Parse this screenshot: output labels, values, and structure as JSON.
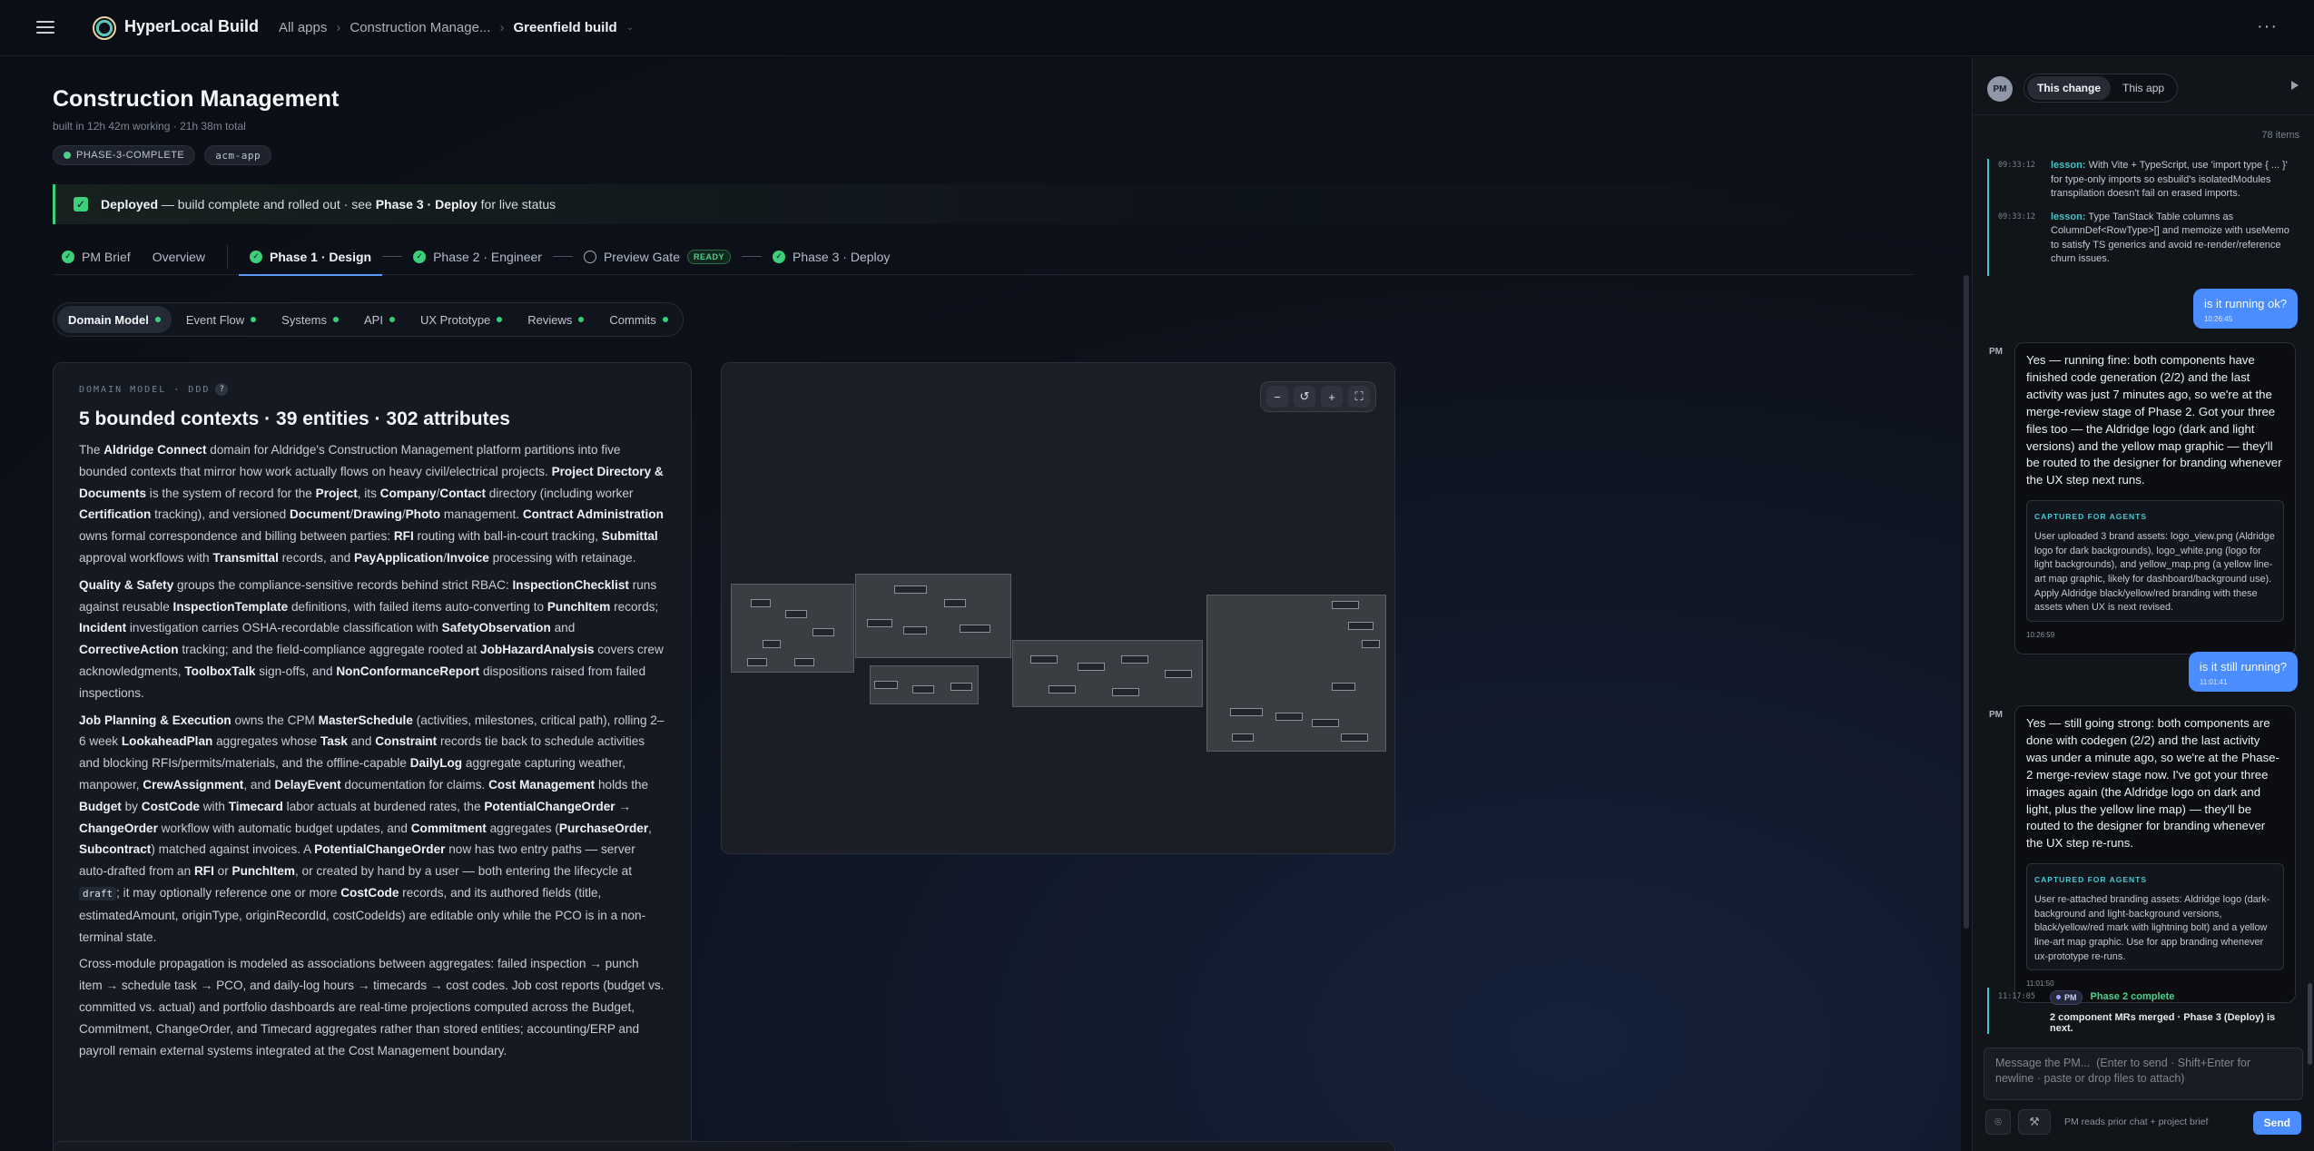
{
  "topbar": {
    "app_name": "HyperLocal Build",
    "crumbs": [
      "All apps",
      "Construction Manage...",
      "Greenfield build"
    ],
    "more": "···"
  },
  "header": {
    "title": "Construction Management",
    "meta": "built in 12h 42m working · 21h 38m total",
    "badges": [
      "PHASE-3-COMPLETE",
      "acm-app"
    ]
  },
  "banner": {
    "strong": "Deployed",
    "text": " — build complete and rolled out · see ",
    "link": "Phase 3 · Deploy",
    "tail": " for live status"
  },
  "phase_tabs": {
    "pm_brief": "PM Brief",
    "overview": "Overview",
    "phase1": "Phase 1 · Design",
    "phase2": "Phase 2 · Engineer",
    "gate": "Preview Gate",
    "ready": "READY",
    "phase3": "Phase 3 · Deploy"
  },
  "sub_tabs": [
    "Domain Model",
    "Event Flow",
    "Systems",
    "API",
    "UX Prototype",
    "Reviews",
    "Commits"
  ],
  "domain_model": {
    "eyebrow": "DOMAIN MODEL · DDD",
    "help": "?",
    "title": "5 bounded contexts · 39 entities · 302 attributes",
    "p1": [
      {
        "t": "The "
      },
      {
        "b": "Aldridge Connect"
      },
      {
        "t": " domain for Aldridge's Construction Management platform partitions into five bounded contexts that mirror how work actually flows on heavy civil/electrical projects. "
      },
      {
        "b": "Project Directory & Documents"
      },
      {
        "t": " is the system of record for the "
      },
      {
        "b": "Project"
      },
      {
        "t": ", its "
      },
      {
        "b": "Company"
      },
      {
        "t": "/"
      },
      {
        "b": "Contact"
      },
      {
        "t": " directory (including worker "
      },
      {
        "b": "Certification"
      },
      {
        "t": " tracking), and versioned "
      },
      {
        "b": "Document"
      },
      {
        "t": "/"
      },
      {
        "b": "Drawing"
      },
      {
        "t": "/"
      },
      {
        "b": "Photo"
      },
      {
        "t": " management. "
      },
      {
        "b": "Contract Administration"
      },
      {
        "t": " owns formal correspondence and billing between parties: "
      },
      {
        "b": "RFI"
      },
      {
        "t": " routing with ball-in-court tracking, "
      },
      {
        "b": "Submittal"
      },
      {
        "t": " approval workflows with "
      },
      {
        "b": "Transmittal"
      },
      {
        "t": " records, and "
      },
      {
        "b": "PayApplication"
      },
      {
        "t": "/"
      },
      {
        "b": "Invoice"
      },
      {
        "t": " processing with retainage."
      }
    ],
    "p2": [
      {
        "b": "Quality & Safety"
      },
      {
        "t": " groups the compliance-sensitive records behind strict RBAC: "
      },
      {
        "b": "InspectionChecklist"
      },
      {
        "t": " runs against reusable "
      },
      {
        "b": "InspectionTemplate"
      },
      {
        "t": " definitions, with failed items auto-converting to "
      },
      {
        "b": "PunchItem"
      },
      {
        "t": " records; "
      },
      {
        "b": "Incident"
      },
      {
        "t": " investigation carries OSHA-recordable classification with "
      },
      {
        "b": "SafetyObservation"
      },
      {
        "t": " and "
      },
      {
        "b": "CorrectiveAction"
      },
      {
        "t": " tracking; and the field-compliance aggregate rooted at "
      },
      {
        "b": "JobHazardAnalysis"
      },
      {
        "t": " covers crew acknowledgments, "
      },
      {
        "b": "ToolboxTalk"
      },
      {
        "t": " sign-offs, and "
      },
      {
        "b": "NonConformanceReport"
      },
      {
        "t": " dispositions raised from failed inspections."
      }
    ],
    "p3": [
      {
        "b": "Job Planning & Execution"
      },
      {
        "t": " owns the CPM "
      },
      {
        "b": "MasterSchedule"
      },
      {
        "t": " (activities, milestones, critical path), rolling 2–6 week "
      },
      {
        "b": "LookaheadPlan"
      },
      {
        "t": " aggregates whose "
      },
      {
        "b": "Task"
      },
      {
        "t": " and "
      },
      {
        "b": "Constraint"
      },
      {
        "t": " records tie back to schedule activities and blocking RFIs/permits/materials, and the offline-capable "
      },
      {
        "b": "DailyLog"
      },
      {
        "t": " aggregate capturing weather, manpower, "
      },
      {
        "b": "CrewAssignment"
      },
      {
        "t": ", and "
      },
      {
        "b": "DelayEvent"
      },
      {
        "t": " documentation for claims. "
      },
      {
        "b": "Cost Management"
      },
      {
        "t": " holds the "
      },
      {
        "b": "Budget"
      },
      {
        "t": " by "
      },
      {
        "b": "CostCode"
      },
      {
        "t": " with "
      },
      {
        "b": "Timecard"
      },
      {
        "t": " labor actuals at burdened rates, the "
      },
      {
        "b": "PotentialChangeOrder"
      },
      {
        "t": " → "
      },
      {
        "b": "ChangeOrder"
      },
      {
        "t": " workflow with automatic budget updates, and "
      },
      {
        "b": "Commitment"
      },
      {
        "t": " aggregates ("
      },
      {
        "b": "PurchaseOrder"
      },
      {
        "t": ", "
      },
      {
        "b": "Subcontract"
      },
      {
        "t": ") matched against invoices. A "
      },
      {
        "b": "PotentialChangeOrder"
      },
      {
        "t": " now has two entry paths — server auto-drafted from an "
      },
      {
        "b": "RFI"
      },
      {
        "t": " or "
      },
      {
        "b": "PunchItem"
      },
      {
        "t": ", or created by hand by a user — both entering the lifecycle at "
      },
      {
        "c": "draft"
      },
      {
        "t": "; it may optionally reference one or more "
      },
      {
        "b": "CostCode"
      },
      {
        "t": " records, and its authored fields (title, estimatedAmount, originType, originRecordId, costCodeIds) are editable only while the PCO is in a non-terminal state."
      }
    ],
    "p4": [
      {
        "t": "Cross-module propagation is modeled as associations between aggregates: failed inspection → punch item → schedule task → PCO, and daily-log hours → timecards → cost codes. Job cost reports (budget vs. committed vs. actual) and portfolio dashboards are real-time projections computed across the Budget, Commitment, ChangeOrder, and Timecard aggregates rather than stored entities; accounting/ERP and payroll remain external systems integrated at the Cost Management boundary."
      }
    ]
  },
  "diagram": {
    "zoom_out": "−",
    "reset": "↺",
    "zoom_in": "+",
    "fullscreen": "⛶"
  },
  "chat": {
    "avatar": "PM",
    "scope": [
      "This change",
      "This app"
    ],
    "count": "78 items",
    "lessons": [
      {
        "ts": "09:33:12",
        "tag": "lesson:",
        "text": " With Vite + TypeScript, use 'import type { ... }' for type-only imports so esbuild's isolatedModules transpilation doesn't fail on erased imports."
      },
      {
        "ts": "09:33:12",
        "tag": "lesson:",
        "text": " Type TanStack Table columns as ColumnDef<RowType>[] and memoize with useMemo to satisfy TS generics and avoid re-render/reference churn issues."
      }
    ],
    "user1": {
      "text": "is it running ok?",
      "time": "10:26:45"
    },
    "pm1": {
      "label": "PM",
      "text": "Yes — running fine: both components have finished code generation (2/2) and the last activity was just 7 minutes ago, so we're at the merge-review stage of Phase 2. Got your three files too — the Aldridge logo (dark and light versions) and the yellow map graphic — they'll be routed to the designer for branding whenever the UX step next runs.",
      "cap_head": "CAPTURED FOR AGENTS",
      "cap_body": "User uploaded 3 brand assets: logo_view.png (Aldridge logo for dark backgrounds), logo_white.png (logo for light backgrounds), and yellow_map.png (a yellow line-art map graphic, likely for dashboard/background use). Apply Aldridge black/yellow/red branding with these assets when UX is next revised.",
      "time": "10:26:59"
    },
    "user2": {
      "text": "is it still running?",
      "time": "11:01:41"
    },
    "pm2": {
      "label": "PM",
      "text": "Yes — still going strong: both components are done with codegen (2/2) and the last activity was under a minute ago, so we're at the Phase-2 merge-review stage now. I've got your three images again (the Aldridge logo on dark and light, plus the yellow line map) — they'll be routed to the designer for branding whenever the UX step re-runs.",
      "cap_head": "CAPTURED FOR AGENTS",
      "cap_body": "User re-attached branding assets: Aldridge logo (dark-background and light-background versions, black/yellow/red mark with lightning bolt) and a yellow line-art map graphic. Use for app branding whenever ux-prototype re-runs.",
      "time": "11:01:50"
    },
    "phase_note": {
      "ts": "11:17:05",
      "chip": "PM",
      "title": "Phase 2 complete",
      "desc": "2 component MRs merged · Phase 3 (Deploy) is next."
    },
    "composer_placeholder": "Message the PM...  (Enter to send · Shift+Enter for newline · paste or drop files to attach)",
    "reads_note": "PM reads prior chat + project brief",
    "send": "Send"
  }
}
